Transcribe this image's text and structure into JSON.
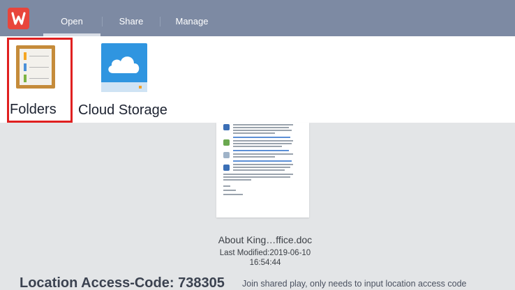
{
  "header": {
    "logo_icon": "wps-logo-icon",
    "tabs": [
      {
        "label": "Open",
        "active": true
      },
      {
        "label": "Share",
        "active": false
      },
      {
        "label": "Manage",
        "active": false
      }
    ],
    "accent": "#7d8aa3"
  },
  "sources": {
    "items": [
      {
        "label": "Folders",
        "icon": "folders-icon",
        "selected": true
      },
      {
        "label": "Cloud Storage",
        "icon": "cloud-storage-icon",
        "selected": false
      }
    ],
    "selection_color": "#e02020"
  },
  "file": {
    "name": "About King…ffice.doc",
    "modified": "Last Modified:2019-06-10",
    "time": "16:54:44"
  },
  "footer": {
    "access_code": "Location Access-Code: 738305",
    "hint": "Join shared play, only needs to input location access code"
  }
}
